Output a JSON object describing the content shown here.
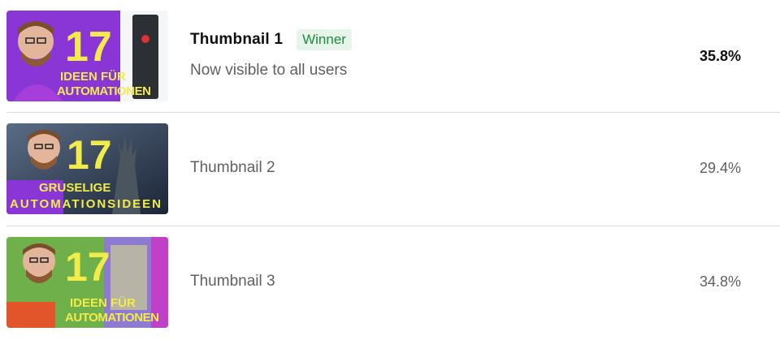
{
  "variants": [
    {
      "title": "Thumbnail 1",
      "badge": "Winner",
      "subtitle": "Now visible to all users",
      "percent": "35.8%",
      "thumbnail": {
        "big_number": "17",
        "line1": "IDEEN FÜR",
        "line2": "AUTOMATIONEN",
        "bg": "#7b2fd0",
        "text_color": "#f2ec4a"
      }
    },
    {
      "title": "Thumbnail 2",
      "percent": "29.4%",
      "thumbnail": {
        "big_number": "17",
        "line1": "GRUSELIGE",
        "line2": "AUTOMATIONSIDEEN",
        "bg": "#2b3a52",
        "text_color": "#f2ec4a"
      }
    },
    {
      "title": "Thumbnail 3",
      "percent": "34.8%",
      "thumbnail": {
        "big_number": "17",
        "line1": "IDEEN FÜR",
        "line2": "AUTOMATIONEN",
        "bg": "#3a8a3a",
        "text_color": "#f2ec4a"
      }
    }
  ],
  "colors": {
    "winner_badge_bg": "#e6f4ea",
    "winner_badge_text": "#1e8e3e",
    "secondary_text": "#606060",
    "divider": "#dcdcdc"
  }
}
